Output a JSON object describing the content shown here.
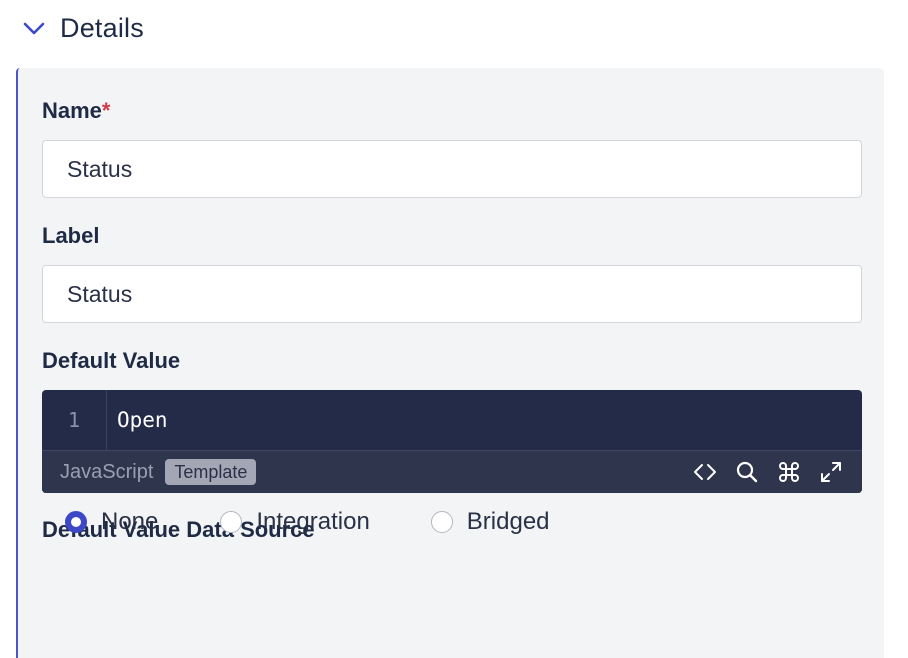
{
  "section": {
    "title": "Details",
    "icon": "chevron-down-icon",
    "accent_color": "#3d48c9"
  },
  "form": {
    "name": {
      "label": "Name",
      "required_mark": "*",
      "value": "Status"
    },
    "label_field": {
      "label": "Label",
      "value": "Status"
    },
    "default_value": {
      "label": "Default Value",
      "editor": {
        "line_number": "1",
        "code": "Open",
        "language": "JavaScript",
        "badge": "Template",
        "tools": [
          "code-brackets-icon",
          "search-icon",
          "command-icon",
          "expand-icon"
        ]
      }
    },
    "data_source": {
      "label": "Default Value Data Source",
      "options": [
        {
          "label": "None",
          "selected": true
        },
        {
          "label": "Integration",
          "selected": false
        },
        {
          "label": "Bridged",
          "selected": false
        }
      ]
    }
  }
}
